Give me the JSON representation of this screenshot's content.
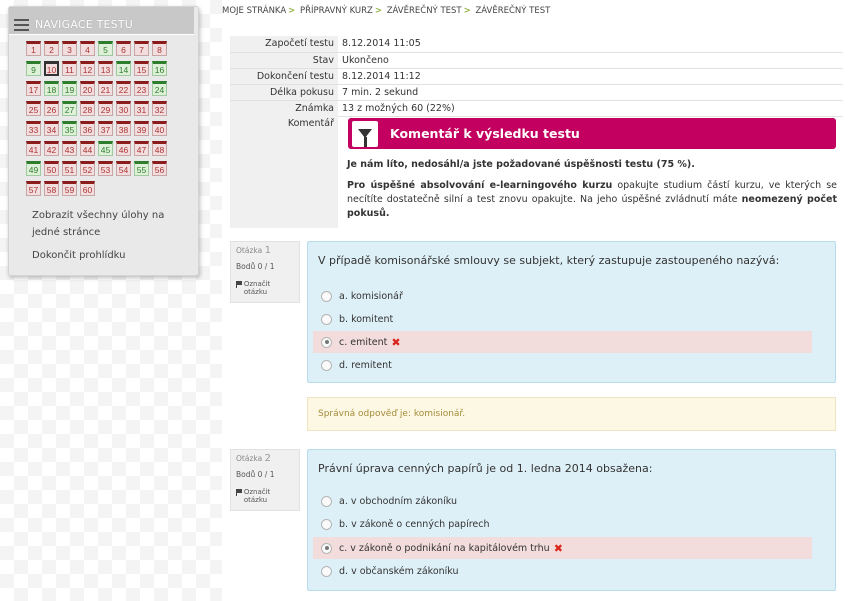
{
  "nav": {
    "title": "NAVIGACE TESTU",
    "questions": [
      {
        "n": "1",
        "state": "incorrect"
      },
      {
        "n": "2",
        "state": "incorrect"
      },
      {
        "n": "3",
        "state": "incorrect"
      },
      {
        "n": "4",
        "state": "incorrect"
      },
      {
        "n": "5",
        "state": "correct"
      },
      {
        "n": "6",
        "state": "incorrect"
      },
      {
        "n": "7",
        "state": "incorrect"
      },
      {
        "n": "8",
        "state": "incorrect"
      },
      {
        "n": "9",
        "state": "correct"
      },
      {
        "n": "10",
        "state": "incorrect"
      },
      {
        "n": "11",
        "state": "incorrect"
      },
      {
        "n": "12",
        "state": "incorrect"
      },
      {
        "n": "13",
        "state": "incorrect"
      },
      {
        "n": "14",
        "state": "correct"
      },
      {
        "n": "15",
        "state": "incorrect"
      },
      {
        "n": "16",
        "state": "correct"
      },
      {
        "n": "17",
        "state": "incorrect"
      },
      {
        "n": "18",
        "state": "correct"
      },
      {
        "n": "19",
        "state": "correct"
      },
      {
        "n": "20",
        "state": "incorrect"
      },
      {
        "n": "21",
        "state": "incorrect"
      },
      {
        "n": "22",
        "state": "incorrect"
      },
      {
        "n": "23",
        "state": "incorrect"
      },
      {
        "n": "24",
        "state": "correct"
      },
      {
        "n": "25",
        "state": "incorrect"
      },
      {
        "n": "26",
        "state": "incorrect"
      },
      {
        "n": "27",
        "state": "correct"
      },
      {
        "n": "28",
        "state": "incorrect"
      },
      {
        "n": "29",
        "state": "incorrect"
      },
      {
        "n": "30",
        "state": "incorrect"
      },
      {
        "n": "31",
        "state": "incorrect"
      },
      {
        "n": "32",
        "state": "incorrect"
      },
      {
        "n": "33",
        "state": "incorrect"
      },
      {
        "n": "34",
        "state": "incorrect"
      },
      {
        "n": "35",
        "state": "correct"
      },
      {
        "n": "36",
        "state": "incorrect"
      },
      {
        "n": "37",
        "state": "incorrect"
      },
      {
        "n": "38",
        "state": "incorrect"
      },
      {
        "n": "39",
        "state": "incorrect"
      },
      {
        "n": "40",
        "state": "incorrect"
      },
      {
        "n": "41",
        "state": "incorrect"
      },
      {
        "n": "42",
        "state": "incorrect"
      },
      {
        "n": "43",
        "state": "incorrect"
      },
      {
        "n": "44",
        "state": "incorrect"
      },
      {
        "n": "45",
        "state": "correct"
      },
      {
        "n": "46",
        "state": "incorrect"
      },
      {
        "n": "47",
        "state": "incorrect"
      },
      {
        "n": "48",
        "state": "incorrect"
      },
      {
        "n": "49",
        "state": "correct"
      },
      {
        "n": "50",
        "state": "incorrect"
      },
      {
        "n": "51",
        "state": "incorrect"
      },
      {
        "n": "52",
        "state": "incorrect"
      },
      {
        "n": "53",
        "state": "incorrect"
      },
      {
        "n": "54",
        "state": "incorrect"
      },
      {
        "n": "55",
        "state": "correct"
      },
      {
        "n": "56",
        "state": "incorrect"
      },
      {
        "n": "57",
        "state": "incorrect"
      },
      {
        "n": "58",
        "state": "incorrect"
      },
      {
        "n": "59",
        "state": "incorrect"
      },
      {
        "n": "60",
        "state": "incorrect"
      }
    ],
    "show_all": "Zobrazit všechny úlohy na jedné stránce",
    "finish_review": "Dokončit prohlídku"
  },
  "breadcrumb": [
    "MOJE STRÁNKA",
    "PŘÍPRAVNÝ KURZ",
    "ZÁVĚREČNÝ TEST",
    "ZÁVĚREČNÝ TEST"
  ],
  "summary": [
    {
      "label": "Započetí testu",
      "value": "8.12.2014 11:05"
    },
    {
      "label": "Stav",
      "value": "Ukončeno"
    },
    {
      "label": "Dokončení testu",
      "value": "8.12.2014 11:12"
    },
    {
      "label": "Délka pokusu",
      "value": "7 min. 2 sekund"
    },
    {
      "label": "Známka",
      "value": "13 z možných 60 (22%)"
    }
  ],
  "feedback": {
    "label": "Komentář",
    "title": "Komentář k výsledku testu",
    "p1": "Je nám líto, nedosáhl/a jste požadované úspěšnosti testu (75 %).",
    "p2_b1": "Pro úspěšné absolvování e-learningového kurzu",
    "p2_t1": " opakujte studium částí kurzu, ve kterých se necítíte dostatečně silní a test znovu opakujte. Na jeho úspěšné zvládnutí máte ",
    "p2_b2": "neomezený počet pokusů."
  },
  "questions": [
    {
      "label": "Otázka",
      "number": "1",
      "grade": "Bodů 0 / 1",
      "flag": "Označit otázku",
      "text": "V případě komisonářské smlouvy se subjekt, který zastupuje zastoupeného nazývá:",
      "answers": [
        {
          "text": "a. komisionář",
          "checked": false,
          "incorrect": false
        },
        {
          "text": "b. komitent",
          "checked": false,
          "incorrect": false
        },
        {
          "text": "c. emitent",
          "checked": true,
          "incorrect": true
        },
        {
          "text": "d. remitent",
          "checked": false,
          "incorrect": false
        }
      ],
      "right_answer": "Správná odpověď je: komisionář."
    },
    {
      "label": "Otázka",
      "number": "2",
      "grade": "Bodů 0 / 1",
      "flag": "Označit otázku",
      "text": "Právní úprava cenných papírů je od 1. ledna 2014 obsažena:",
      "answers": [
        {
          "text": "a. v obchodním zákoníku",
          "checked": false,
          "incorrect": false
        },
        {
          "text": "b. v zákoně o cenných papírech",
          "checked": false,
          "incorrect": false
        },
        {
          "text": "c. v zákoně o podnikání na kapitálovém trhu",
          "checked": true,
          "incorrect": true
        },
        {
          "text": "d. v občanském zákoníku",
          "checked": false,
          "incorrect": false
        }
      ]
    }
  ],
  "colors": {
    "banner": "#c3005f",
    "question_bg": "#def0f7",
    "incorrect_bg": "#f3dcdc",
    "outcome_bg": "#fcf8e3"
  }
}
